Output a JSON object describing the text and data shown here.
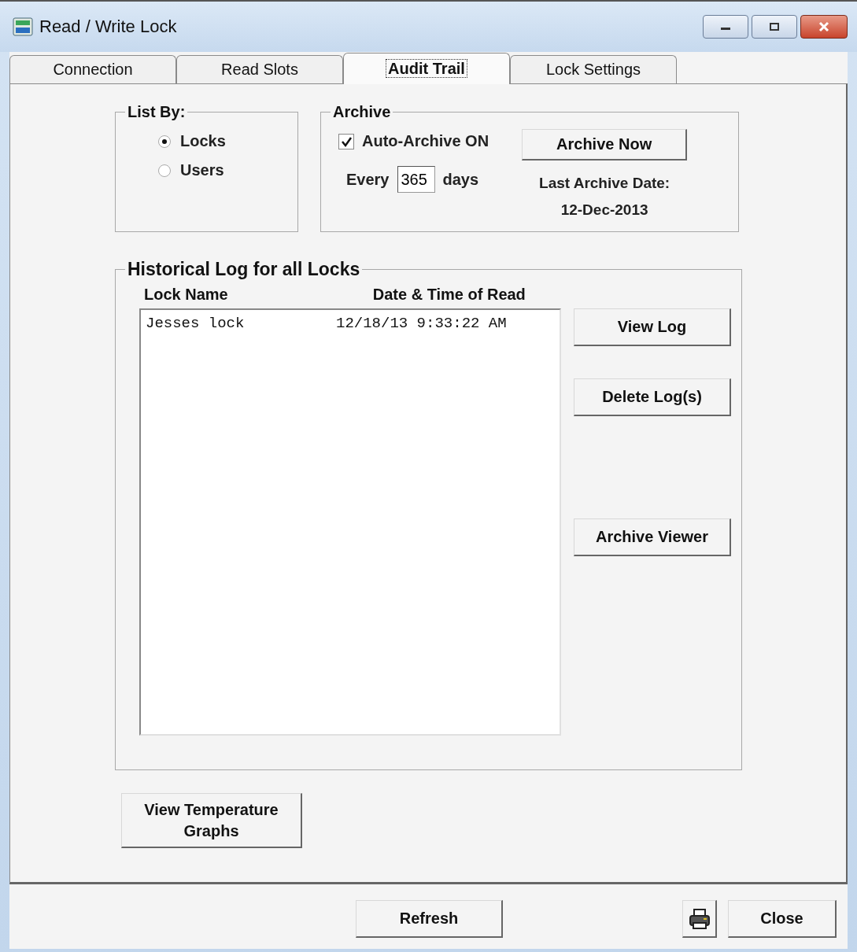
{
  "window": {
    "title": "Read / Write Lock"
  },
  "tabs": [
    {
      "label": "Connection",
      "selected": false
    },
    {
      "label": "Read Slots",
      "selected": false
    },
    {
      "label": "Audit Trail",
      "selected": true
    },
    {
      "label": "Lock Settings",
      "selected": false
    }
  ],
  "list_by": {
    "title": "List By:",
    "options": [
      {
        "label": "Locks",
        "selected": true
      },
      {
        "label": "Users",
        "selected": false
      }
    ]
  },
  "archive": {
    "title": "Archive",
    "auto_archive": {
      "label": "Auto-Archive ON",
      "checked": true
    },
    "every_label": "Every",
    "days_value": "365",
    "days_label": "days",
    "button": "Archive Now",
    "last_date_label": "Last Archive Date:",
    "last_date": "12-Dec-2013"
  },
  "history": {
    "title": "Historical Log for all Locks",
    "columns": [
      "Lock Name",
      "Date & Time of Read"
    ],
    "rows": [
      {
        "lock_name": "Jesses lock",
        "date_time": "12/18/13 9:33:22 AM"
      }
    ],
    "buttons": [
      "View Log",
      "Delete Log(s)",
      "Archive Viewer"
    ]
  },
  "temperature_button": "View Temperature Graphs",
  "footer": {
    "refresh": "Refresh",
    "close": "Close"
  }
}
